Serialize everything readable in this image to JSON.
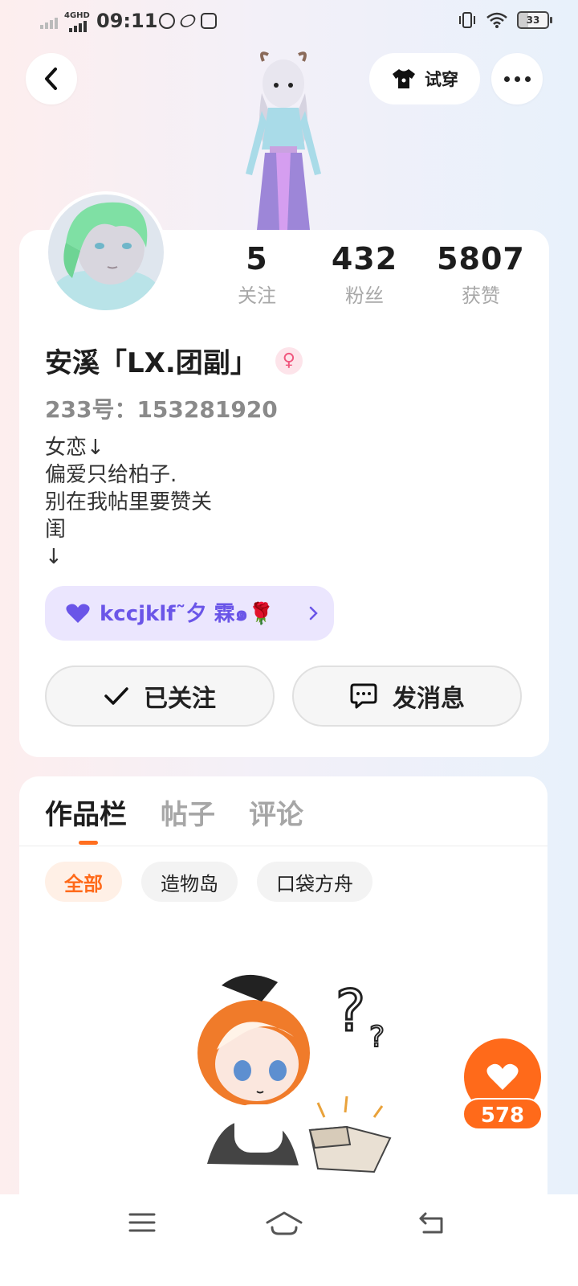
{
  "status_bar": {
    "network": "4GHD",
    "time": "09:11",
    "battery": "33"
  },
  "header": {
    "try_on_label": "试穿"
  },
  "profile": {
    "stats": [
      {
        "value": "5",
        "label": "关注"
      },
      {
        "value": "432",
        "label": "粉丝"
      },
      {
        "value": "5807",
        "label": "获赞"
      }
    ],
    "name": "安溪「LX.团副」",
    "gender_symbol": "♀",
    "uid": "233号：153281920",
    "bio_lines": [
      "女恋↓",
      "偏爱只给柏子.",
      "别在我帖里要赞关",
      "闺",
      "↓"
    ],
    "couple_tag": "kccjklf˜夕 霖๑🌹",
    "follow_label": "已关注",
    "message_label": "发消息"
  },
  "works": {
    "tabs": [
      "作品栏",
      "帖子",
      "评论"
    ],
    "active_tab": 0,
    "filters": [
      "全部",
      "造物岛",
      "口袋方舟"
    ],
    "active_filter": 0
  },
  "floating_like": {
    "count": "578"
  },
  "colors": {
    "accent": "#ff6a1a",
    "couple_bg": "#ebe6fe",
    "couple_text": "#6a55e8"
  }
}
